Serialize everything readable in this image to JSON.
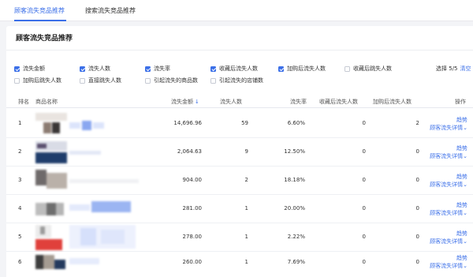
{
  "tabs": [
    {
      "label": "顾客流失竞品推荐",
      "active": true
    },
    {
      "label": "搜索流失竞品推荐",
      "active": false
    }
  ],
  "card": {
    "title": "顾客流失竞品推荐"
  },
  "metrics": [
    {
      "label": "流失金额",
      "checked": true
    },
    {
      "label": "流失人数",
      "checked": true
    },
    {
      "label": "流失率",
      "checked": true
    },
    {
      "label": "收藏后流失人数",
      "checked": true
    },
    {
      "label": "加购后流失人数",
      "checked": true
    },
    {
      "label": "收藏后跳失人数",
      "checked": false
    },
    {
      "label": "加购后跳失人数",
      "checked": false
    },
    {
      "label": "直接跳失人数",
      "checked": false
    },
    {
      "label": "引起流失的商品数",
      "checked": false
    },
    {
      "label": "引起流失的店铺数",
      "checked": false
    }
  ],
  "selection": {
    "count": "选择 5/5",
    "clear": "清空"
  },
  "table": {
    "columns": [
      "排名",
      "商品名称",
      "流失金额",
      "流失人数",
      "流失率",
      "收藏后流失人数",
      "加购后流失人数",
      "操作"
    ],
    "sort_indicator": "↓",
    "rows": [
      {
        "rank": "1",
        "amount": "14,696.96",
        "people": "59",
        "rate": "6.60%",
        "fav": "0",
        "cart": "2",
        "op_trend": "趋势",
        "op_detail": "顾客流失详情⌄"
      },
      {
        "rank": "2",
        "amount": "2,064.63",
        "people": "9",
        "rate": "12.50%",
        "fav": "0",
        "cart": "0",
        "op_trend": "趋势",
        "op_detail": "顾客流失详情⌄"
      },
      {
        "rank": "3",
        "amount": "904.00",
        "people": "2",
        "rate": "18.18%",
        "fav": "0",
        "cart": "0",
        "op_trend": "趋势",
        "op_detail": "顾客流失详情⌄"
      },
      {
        "rank": "4",
        "amount": "281.00",
        "people": "1",
        "rate": "20.00%",
        "fav": "0",
        "cart": "0",
        "op_trend": "趋势",
        "op_detail": "顾客流失详情⌄"
      },
      {
        "rank": "5",
        "amount": "278.00",
        "people": "1",
        "rate": "2.22%",
        "fav": "0",
        "cart": "0",
        "op_trend": "趋势",
        "op_detail": "顾客流失详情⌄"
      },
      {
        "rank": "6",
        "amount": "260.00",
        "people": "1",
        "rate": "7.69%",
        "fav": "0",
        "cart": "0",
        "op_trend": "趋势",
        "op_detail": "顾客流失详情⌄"
      }
    ]
  },
  "colors": {
    "accent": "#3b6fe8",
    "text": "#333333",
    "background": "#f3f4f7"
  }
}
